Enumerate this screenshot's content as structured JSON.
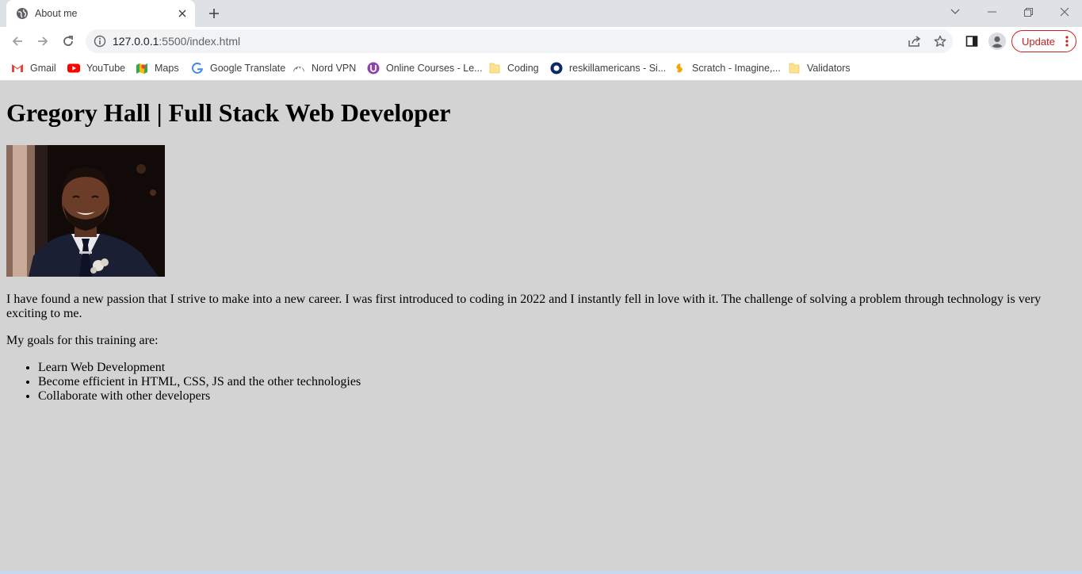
{
  "browser": {
    "tab": {
      "title": "About me"
    },
    "address": {
      "host": "127.0.0.1",
      "path": ":5500/index.html"
    },
    "update_label": "Update",
    "bookmarks": [
      {
        "label": "Gmail",
        "icon": "gmail-icon"
      },
      {
        "label": "YouTube",
        "icon": "youtube-icon"
      },
      {
        "label": "Maps",
        "icon": "maps-icon"
      },
      {
        "label": "Google Translate",
        "icon": "google-icon"
      },
      {
        "label": "Nord VPN",
        "icon": "nordvpn-icon"
      },
      {
        "label": "Online Courses - Le...",
        "icon": "courses-icon"
      },
      {
        "label": "Coding",
        "icon": "folder-icon"
      },
      {
        "label": "reskillamericans - Si...",
        "icon": "reskill-icon"
      },
      {
        "label": "Scratch - Imagine,...",
        "icon": "scratch-icon"
      },
      {
        "label": "Validators",
        "icon": "folder-icon"
      }
    ]
  },
  "page": {
    "heading": "Gregory Hall | Full Stack Web Developer",
    "photo_alt": "profile-photo",
    "paragraph": "I have found a new passion that I strive to make into a new career. I was first introduced to coding in 2022 and I instantly fell in love with it. The challenge of solving a problem through technology is very exciting to me.",
    "goals_intro": "My goals for this training are:",
    "goals": [
      "Learn Web Development",
      "Become efficient in HTML, CSS, JS and the other technologies",
      "Collaborate with other developers"
    ]
  },
  "colors": {
    "page_background": "#d3d3d3",
    "update_accent": "#c5221f",
    "tabstrip": "#dee1e6"
  }
}
